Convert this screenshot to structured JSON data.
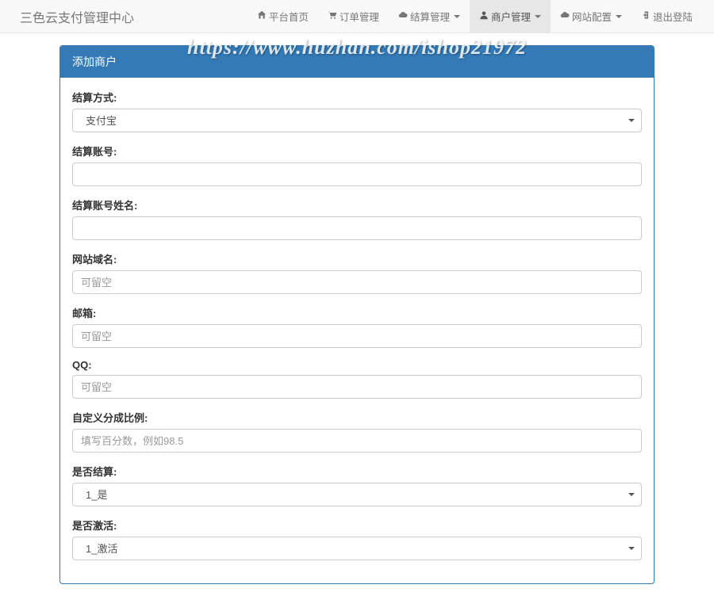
{
  "brand": "三色云支付管理中心",
  "nav": {
    "home": "平台首页",
    "orders": "订单管理",
    "settlement": "结算管理",
    "merchants": "商户管理",
    "site": "网站配置",
    "logout": "退出登陆"
  },
  "panel": {
    "title": "添加商户"
  },
  "form": {
    "settle_method": {
      "label": "结算方式:",
      "value": "支付宝"
    },
    "settle_account": {
      "label": "结算账号:",
      "value": ""
    },
    "settle_name": {
      "label": "结算账号姓名:",
      "value": ""
    },
    "domain": {
      "label": "网站域名:",
      "placeholder": "可留空",
      "value": ""
    },
    "email": {
      "label": "邮箱:",
      "placeholder": "可留空",
      "value": ""
    },
    "qq": {
      "label": "QQ:",
      "placeholder": "可留空",
      "value": ""
    },
    "custom_ratio": {
      "label": "自定义分成比例:",
      "placeholder": "填写百分数，例如98.5",
      "value": ""
    },
    "is_settle": {
      "label": "是否结算:",
      "value": "1_是"
    },
    "is_active": {
      "label": "是否激活:",
      "value": "1_激活"
    }
  },
  "watermark": "https://www.huzhan.com/ishop21972"
}
